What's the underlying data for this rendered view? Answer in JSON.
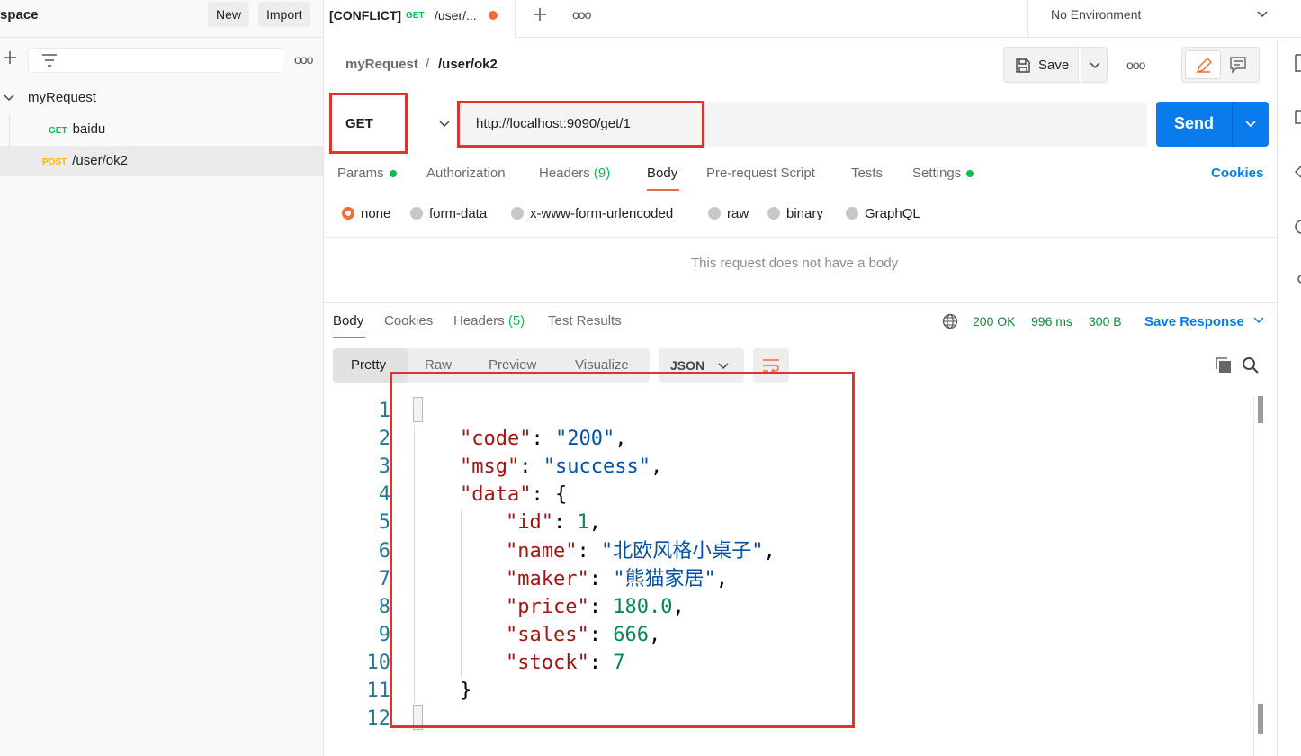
{
  "colors": {
    "accent": "#097bed",
    "highlight_red": "#e3312d",
    "status_green": "#0cbb52",
    "post_orange": "#ffb400",
    "active_tab": "#f26b3a"
  },
  "sidebar": {
    "workspace_title": "space",
    "new_label": "New",
    "import_label": "Import",
    "collection": "myRequest",
    "requests": [
      {
        "method": "GET",
        "name": "baidu"
      },
      {
        "method": "POST",
        "name": "/user/ok2"
      }
    ]
  },
  "tabs": {
    "active_tab": {
      "prefix": "[CONFLICT]",
      "method": "GET",
      "title": "/user/..."
    },
    "environment": "No Environment"
  },
  "breadcrumb": {
    "collection": "myRequest",
    "separator": "/",
    "request": "/user/ok2"
  },
  "toolbar": {
    "save_label": "Save"
  },
  "request": {
    "method": "GET",
    "url": "http://localhost:9090/get/1",
    "send_label": "Send",
    "tabs": [
      {
        "label": "Params",
        "dot": true
      },
      {
        "label": "Authorization"
      },
      {
        "label": "Headers",
        "count": "(9)"
      },
      {
        "label": "Body",
        "active": true
      },
      {
        "label": "Pre-request Script"
      },
      {
        "label": "Tests"
      },
      {
        "label": "Settings",
        "dot": true
      }
    ],
    "cookies_label": "Cookies",
    "body_modes": [
      "none",
      "form-data",
      "x-www-form-urlencoded",
      "raw",
      "binary",
      "GraphQL"
    ],
    "selected_mode": "none",
    "empty_body_text": "This request does not have a body"
  },
  "response": {
    "tabs": [
      {
        "label": "Body",
        "active": true
      },
      {
        "label": "Cookies"
      },
      {
        "label": "Headers",
        "count": "(5)"
      },
      {
        "label": "Test Results"
      }
    ],
    "status": "200 OK",
    "time": "996 ms",
    "size": "300 B",
    "save_label": "Save Response",
    "view_modes": [
      "Pretty",
      "Raw",
      "Preview",
      "Visualize"
    ],
    "format": "JSON",
    "lines": [
      {
        "n": "1",
        "text": "{"
      },
      {
        "n": "2",
        "key": "\"code\"",
        "value": "\"200\"",
        "vtype": "s",
        "tail": ","
      },
      {
        "n": "3",
        "key": "\"msg\"",
        "value": "\"success\"",
        "vtype": "s",
        "tail": ","
      },
      {
        "n": "4",
        "key": "\"data\"",
        "value": "{",
        "vtype": "p",
        "tail": ""
      },
      {
        "n": "5",
        "key": "\"id\"",
        "value": "1",
        "vtype": "n",
        "tail": ","
      },
      {
        "n": "6",
        "key": "\"name\"",
        "value": "\"北欧风格小桌子\"",
        "vtype": "s",
        "tail": ","
      },
      {
        "n": "7",
        "key": "\"maker\"",
        "value": "\"熊猫家居\"",
        "vtype": "s",
        "tail": ","
      },
      {
        "n": "8",
        "key": "\"price\"",
        "value": "180.0",
        "vtype": "n",
        "tail": ","
      },
      {
        "n": "9",
        "key": "\"sales\"",
        "value": "666",
        "vtype": "n",
        "tail": ","
      },
      {
        "n": "10",
        "key": "\"stock\"",
        "value": "7",
        "vtype": "n",
        "tail": ""
      },
      {
        "n": "11",
        "text": "}"
      },
      {
        "n": "12",
        "text": "}"
      }
    ]
  }
}
